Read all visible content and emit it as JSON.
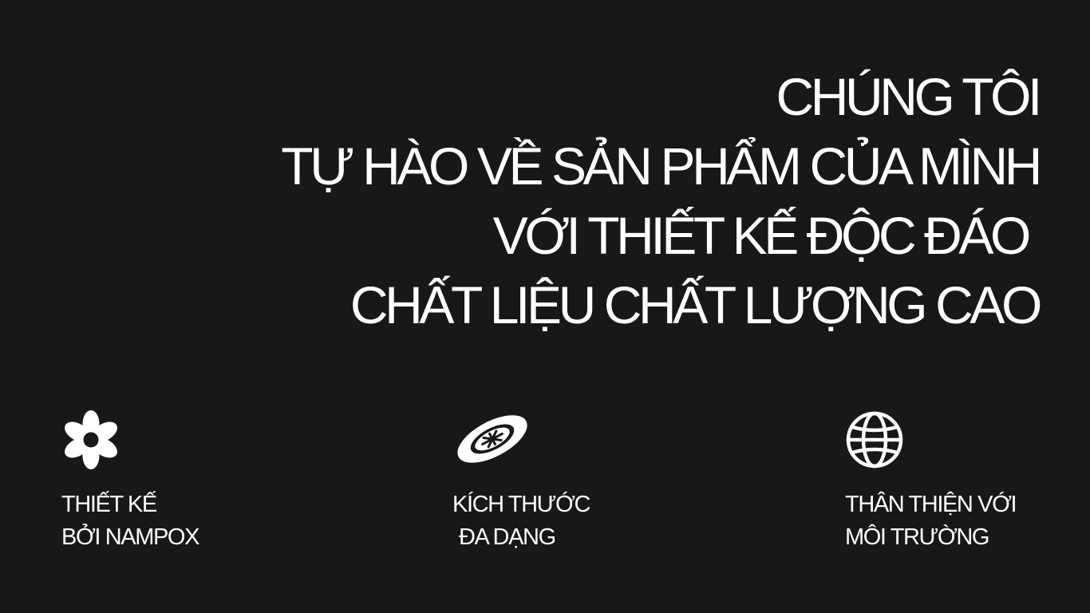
{
  "hero": {
    "lines": [
      "CHÚNG TÔI",
      "TỰ HÀO VỀ SẢN PHẨM CỦA MÌNH",
      "VỚI THIẾT KẾ ĐỘC ĐÁO",
      "CHẤT LIỆU CHẤT LƯỢNG CAO"
    ]
  },
  "features": [
    {
      "icon": "flower-icon",
      "line1": "THIẾT KẾ",
      "line2": "BỞI NAMPOX"
    },
    {
      "icon": "size-disc-icon",
      "line1": "KÍCH THƯỚC",
      "line2": "ĐA DẠNG"
    },
    {
      "icon": "globe-icon",
      "line1": "THÂN THIỆN VỚI",
      "line2": "MÔI TRƯỜNG"
    }
  ],
  "colors": {
    "background": "#181818",
    "text": "#ffffff"
  }
}
